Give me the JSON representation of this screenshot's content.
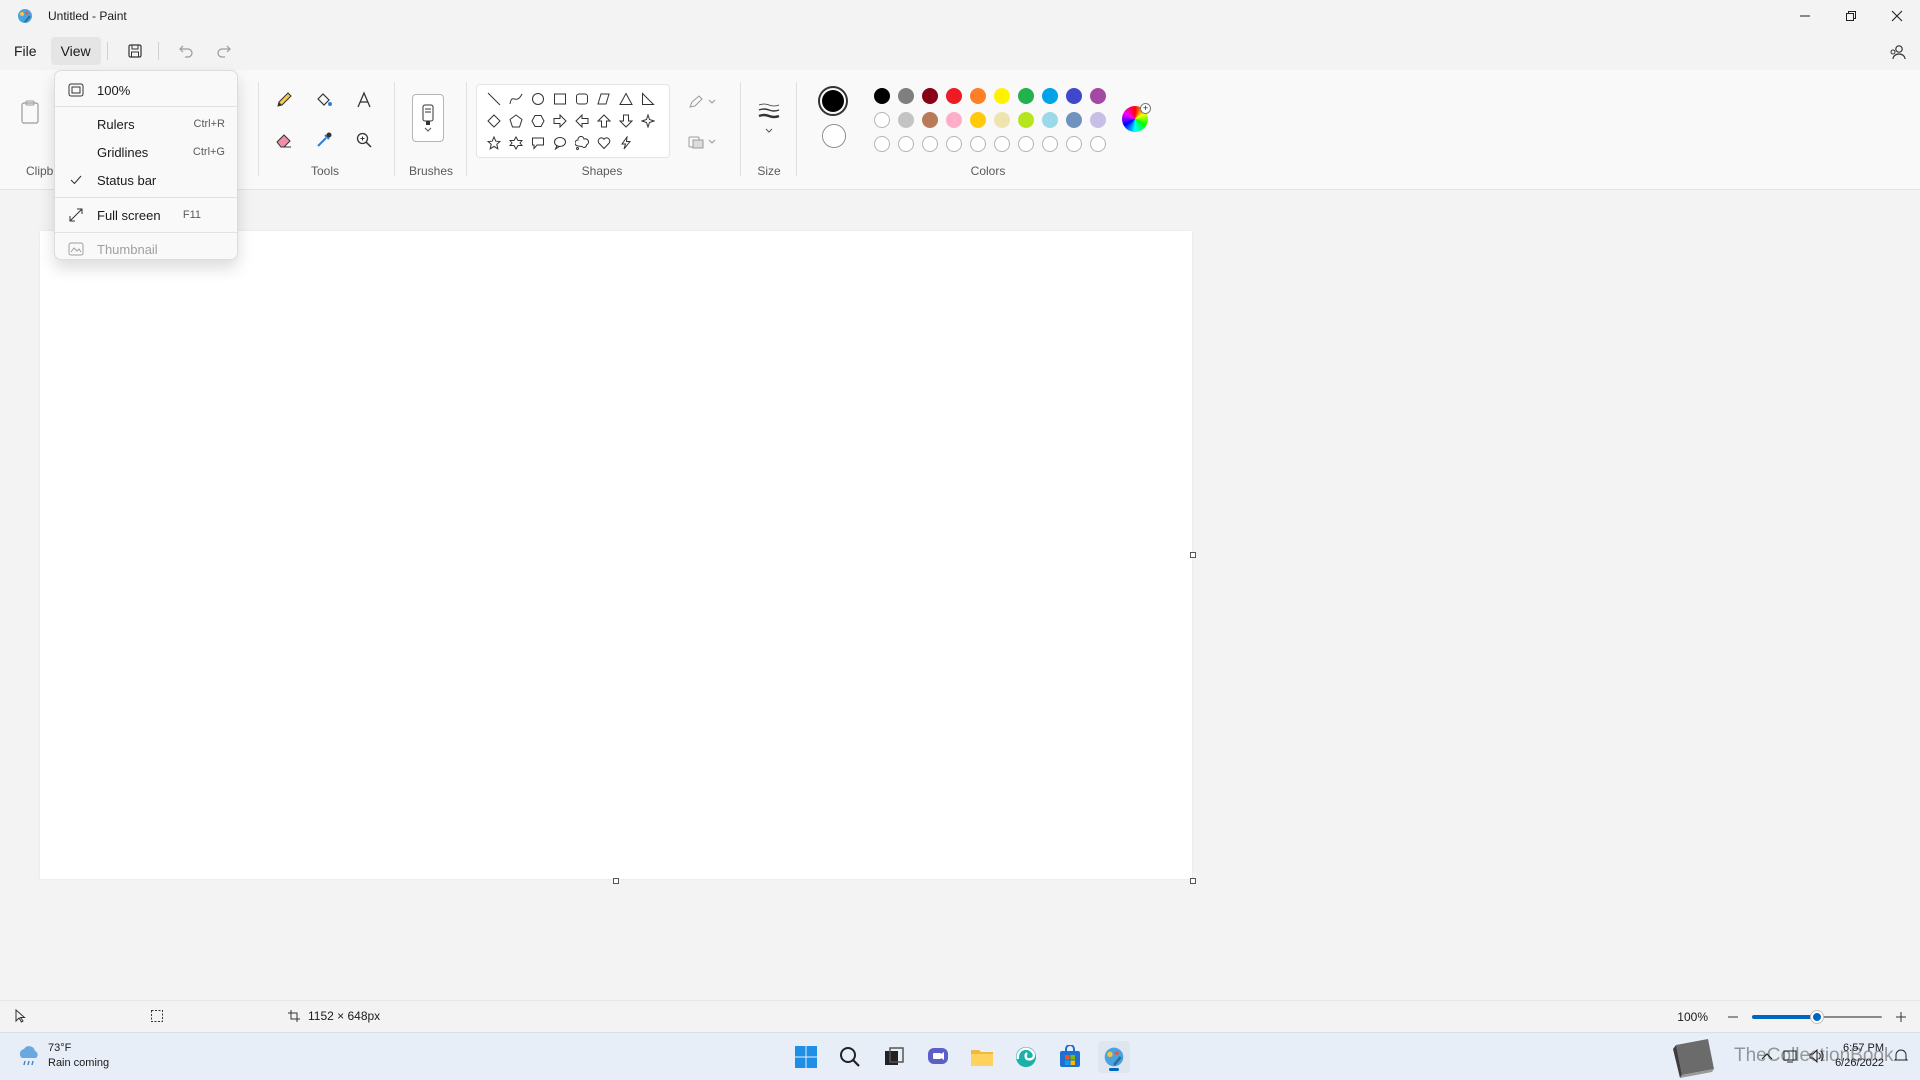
{
  "window": {
    "title": "Untitled - Paint"
  },
  "menu": {
    "file": "File",
    "view": "View"
  },
  "ribbon": {
    "clipboard_label": "Clipb",
    "tools_label": "Tools",
    "brushes_label": "Brushes",
    "shapes_label": "Shapes",
    "size_label": "Size",
    "colors_label": "Colors"
  },
  "colors": {
    "primary": "#000000",
    "secondary": "#ffffff",
    "row1": [
      "#000000",
      "#7f7f7f",
      "#880015",
      "#ed1c24",
      "#ff7f27",
      "#fff200",
      "#22b14c",
      "#00a2e8",
      "#3f48cc",
      "#a349a4"
    ],
    "row2": [
      "#ffffff",
      "#c3c3c3",
      "#b97a57",
      "#ffaec9",
      "#ffc90e",
      "#efe4b0",
      "#b5e61d",
      "#99d9ea",
      "#7092be",
      "#c8bfe7"
    ]
  },
  "view_menu": {
    "zoom": "100%",
    "rulers": "Rulers",
    "rulers_shortcut": "Ctrl+R",
    "gridlines": "Gridlines",
    "gridlines_shortcut": "Ctrl+G",
    "status_bar": "Status bar",
    "full_screen": "Full screen",
    "full_screen_shortcut": "F11",
    "thumbnail": "Thumbnail"
  },
  "status": {
    "canvas_size": "1152 × 648px",
    "zoom": "100%",
    "zoom_level": 0.5
  },
  "taskbar": {
    "weather_temp": "73°F",
    "weather_desc": "Rain coming",
    "time": "6:57 PM",
    "date": "6/26/2022",
    "watermark": "TheCollectionBook"
  }
}
